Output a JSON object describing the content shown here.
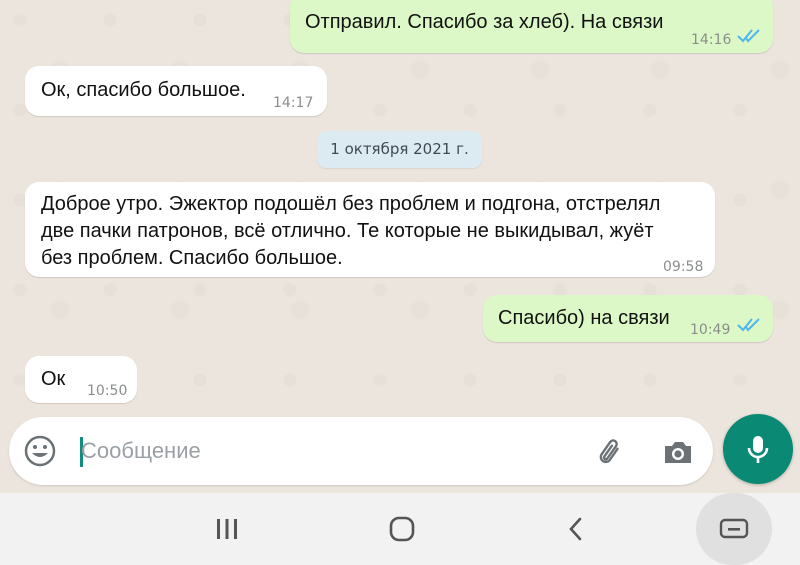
{
  "messages": [
    {
      "direction": "outgoing",
      "text": "Отправил. Спасибо за хлеб). На связи",
      "time": "14:16",
      "status": "read"
    },
    {
      "direction": "incoming",
      "text": "Ок, спасибо большое.",
      "time": "14:17"
    },
    {
      "direction": "incoming",
      "lines": [
        "Доброе утро. Эжектор подошёл без проблем и подгона, отстрелял",
        "две пачки патронов, всё отлично. Те которые не выкидывал, жуёт",
        "без проблем. Спасибо большое."
      ],
      "time": "09:58"
    },
    {
      "direction": "outgoing",
      "text": "Спасибо) на связи",
      "time": "10:49",
      "status": "read"
    },
    {
      "direction": "incoming",
      "text": "Ок",
      "time": "10:50"
    }
  ],
  "date_separator": "1 октября 2021 г.",
  "composer": {
    "placeholder": "Сообщение"
  },
  "icons": {
    "emoji": "emoji-icon",
    "attach": "paperclip-icon",
    "camera": "camera-icon",
    "mic": "microphone-icon",
    "read_receipt": "double-check-icon"
  },
  "colors": {
    "outgoing_bubble": "#dcf8c6",
    "incoming_bubble": "#ffffff",
    "mic_button": "#0a8a74",
    "read_check": "#4fb6ec"
  }
}
